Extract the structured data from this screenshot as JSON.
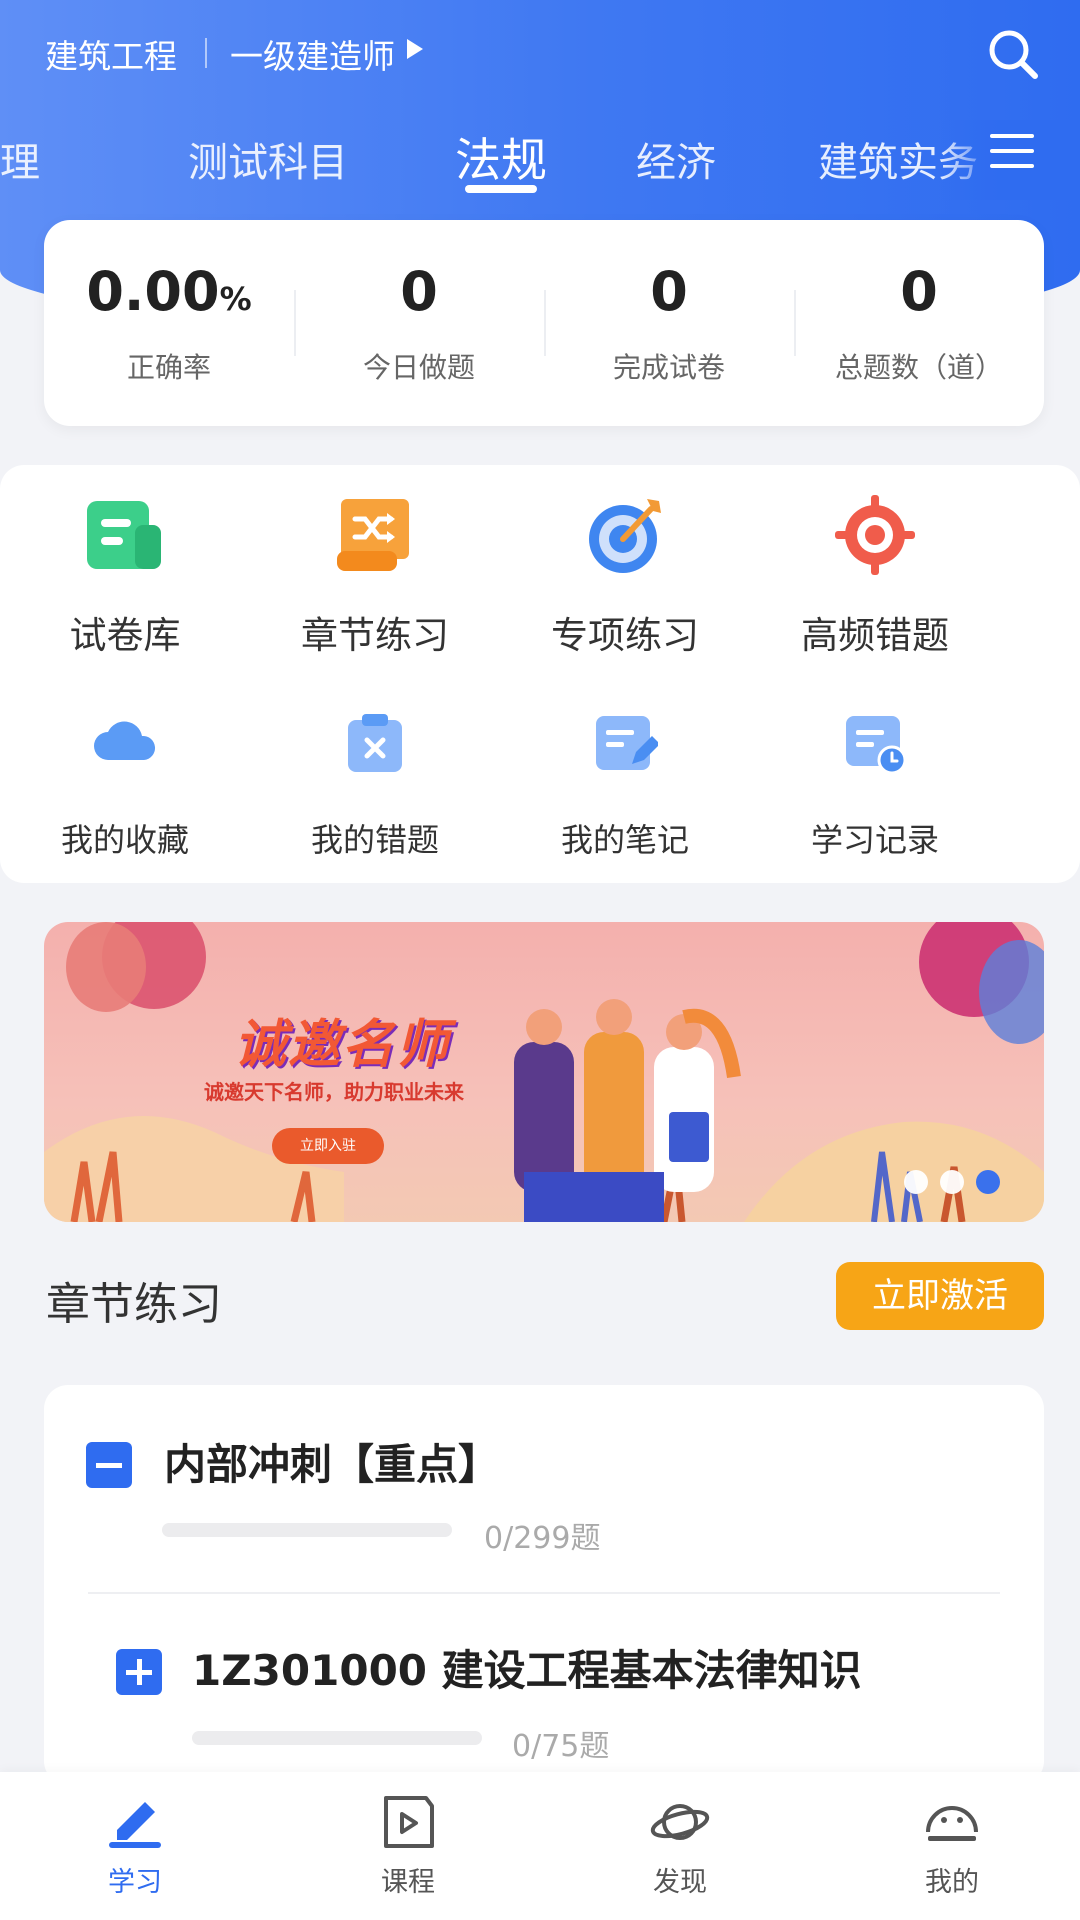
{
  "header": {
    "subject": "建筑工程",
    "level": "一级建造师",
    "search_icon": "search-icon"
  },
  "tabs": [
    {
      "label": "管理",
      "visible_text": "管理"
    },
    {
      "label": "测试科目"
    },
    {
      "label": "法规",
      "active": true
    },
    {
      "label": "经济"
    },
    {
      "label": "建筑实务"
    }
  ],
  "stats": [
    {
      "value": "0.00",
      "unit": "%",
      "label": "正确率"
    },
    {
      "value": "0",
      "label": "今日做题"
    },
    {
      "value": "0",
      "label": "完成试卷"
    },
    {
      "value": "0",
      "label": "总题数（道）"
    }
  ],
  "features_primary": [
    {
      "label": "试卷库",
      "icon": "paper-library-icon",
      "color": "#3ccf8a"
    },
    {
      "label": "章节练习",
      "icon": "shuffle-scroll-icon",
      "color": "#f7a23b"
    },
    {
      "label": "专项练习",
      "icon": "target-dart-icon",
      "color": "#3f86f0"
    },
    {
      "label": "高频错题",
      "icon": "crosshair-icon",
      "color": "#f05c4b"
    }
  ],
  "features_secondary": [
    {
      "label": "我的收藏",
      "icon": "cloud-icon"
    },
    {
      "label": "我的错题",
      "icon": "clipboard-x-icon"
    },
    {
      "label": "我的笔记",
      "icon": "note-edit-icon"
    },
    {
      "label": "学习记录",
      "icon": "record-clock-icon"
    }
  ],
  "banner": {
    "headline": "诚邀名师",
    "subtitle": "诚邀天下名师，助力职业未来",
    "cta": "立即入驻",
    "active_dot": 2,
    "dot_count": 3
  },
  "chapter_section": {
    "title": "章节练习",
    "activate_label": "立即激活",
    "items": [
      {
        "title": "内部冲刺【重点】",
        "count": "0/299题",
        "expanded": true,
        "progress": 0
      },
      {
        "title": "1Z301000 建设工程基本法律知识",
        "count": "0/75题",
        "expanded": false,
        "progress": 0
      }
    ]
  },
  "bottom_nav": [
    {
      "label": "学习",
      "icon": "pencil-icon",
      "active": true
    },
    {
      "label": "课程",
      "icon": "video-play-icon"
    },
    {
      "label": "发现",
      "icon": "planet-icon"
    },
    {
      "label": "我的",
      "icon": "smiley-face-icon"
    }
  ],
  "colors": {
    "primary": "#2f6cf0",
    "accent_orange": "#f7a516"
  }
}
